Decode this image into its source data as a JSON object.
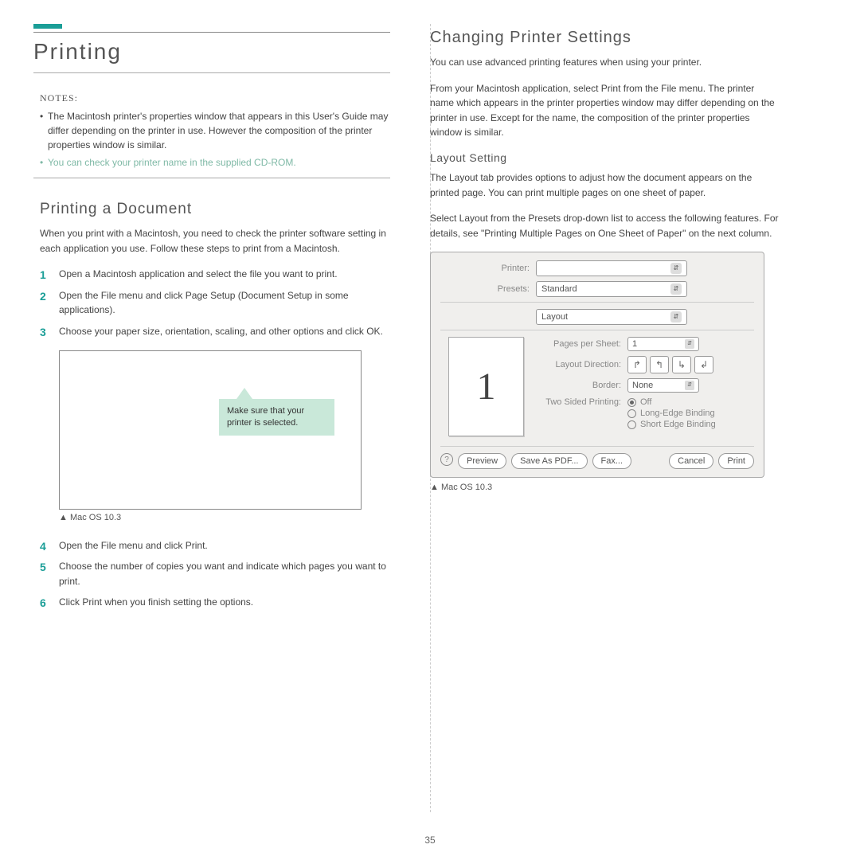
{
  "left": {
    "main_heading": "Printing",
    "notes_label": "NOTES:",
    "notes": {
      "n1": "The Macintosh printer's properties window that appears in this User's Guide may differ depending on the printer in use. However the composition of the printer properties window is similar.",
      "n2": "You can check your printer name in the supplied CD-ROM."
    },
    "sub_heading": "Printing a Document",
    "intro": "When you print with a Macintosh, you need to check the printer software setting in each application you use. Follow these steps to print from a Macintosh.",
    "steps_a": {
      "s1": "Open a Macintosh application and select the file you want to print.",
      "s2": "Open the File menu and click Page Setup (Document Setup in some applications).",
      "s3": "Choose your paper size, orientation, scaling, and other options and click OK."
    },
    "callout": "Make sure that your printer is selected.",
    "caption1": "Mac OS 10.3",
    "steps_b": {
      "s4": "Open the File menu and click Print.",
      "s5": "Choose the number of copies you want and indicate which pages you want to print.",
      "s6": "Click Print when you finish setting the options."
    }
  },
  "right": {
    "heading": "Changing Printer Settings",
    "p1": "You can use advanced printing features when using your printer.",
    "p2": "From your Macintosh application, select Print from the File menu. The printer name which appears in the printer properties window may differ depending on the printer in use. Except for the name, the composition of the printer properties window is similar.",
    "layout_heading": "Layout Setting",
    "p3": "The Layout tab provides options to adjust how the document appears on the printed page. You can print multiple pages on one sheet of paper.",
    "p4": "Select Layout from the Presets drop-down list to access the following features. For details, see \"Printing Multiple Pages on One Sheet of Paper\" on the next column.",
    "dialog": {
      "printer_label": "Printer:",
      "printer_value": "",
      "presets_label": "Presets:",
      "presets_value": "Standard",
      "pane_value": "Layout",
      "pps_label": "Pages per Sheet:",
      "pps_value": "1",
      "dir_label": "Layout Direction:",
      "border_label": "Border:",
      "border_value": "None",
      "twosided_label": "Two Sided Printing:",
      "radio_off": "Off",
      "radio_long": "Long-Edge Binding",
      "radio_short": "Short Edge Binding",
      "preview_num": "1",
      "btn_preview": "Preview",
      "btn_savepdf": "Save As PDF...",
      "btn_fax": "Fax...",
      "btn_cancel": "Cancel",
      "btn_print": "Print",
      "help": "?"
    },
    "caption2": "Mac OS 10.3"
  },
  "page_number": "35"
}
